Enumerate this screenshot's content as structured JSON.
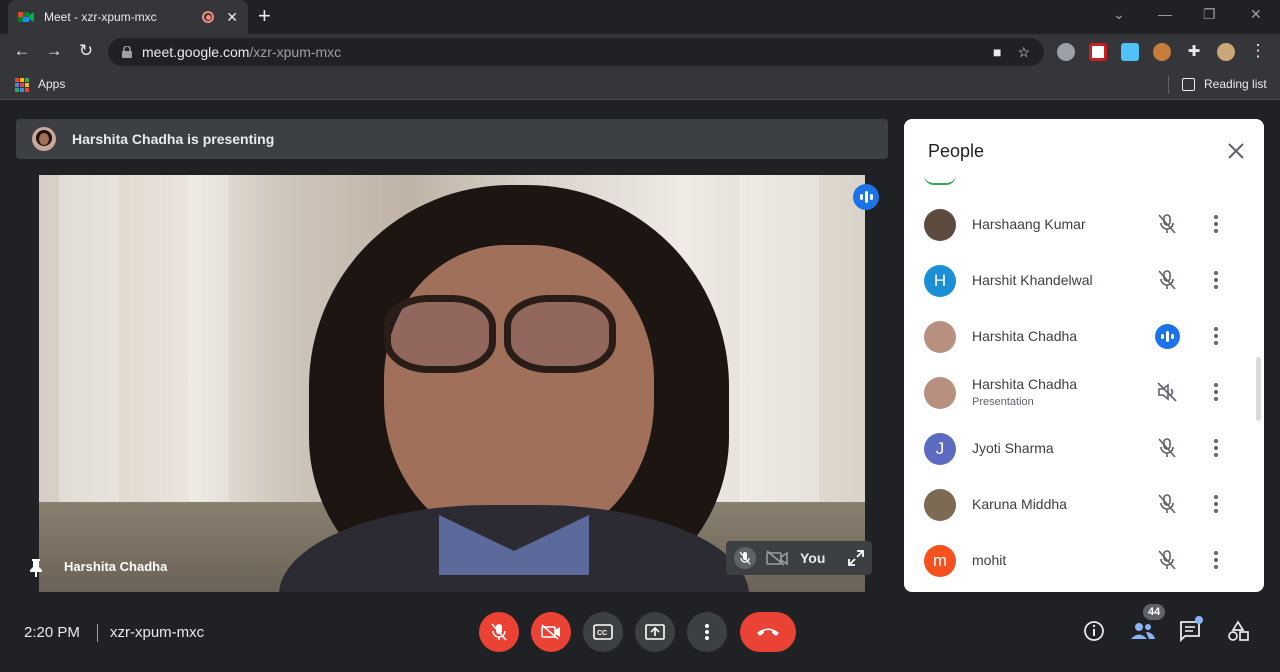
{
  "browser": {
    "tab_title": "Meet - xzr-xpum-mxc",
    "url_host": "meet.google.com",
    "url_path": "/xzr-xpum-mxc",
    "bookmarks": {
      "apps_label": "Apps",
      "reading_list_label": "Reading list"
    }
  },
  "meeting": {
    "presenting_banner": "Harshita Chadha is presenting",
    "main_video_name": "Harshita Chadha",
    "self_tile_label": "You",
    "time": "2:20 PM",
    "code": "xzr-xpum-mxc",
    "participant_count": "44"
  },
  "people_panel": {
    "title": "People",
    "participants": [
      {
        "name": "Harshaang Kumar",
        "sub": "",
        "avatar_letter": "",
        "avatar_color": "#5c4a3f",
        "state": "muted"
      },
      {
        "name": "Harshit Khandelwal",
        "sub": "",
        "avatar_letter": "H",
        "avatar_color": "#1a8fd6",
        "state": "muted"
      },
      {
        "name": "Harshita Chadha",
        "sub": "",
        "avatar_letter": "",
        "avatar_color": "#b89080",
        "state": "speaking"
      },
      {
        "name": "Harshita Chadha",
        "sub": "Presentation",
        "avatar_letter": "",
        "avatar_color": "#b89080",
        "state": "audio-off"
      },
      {
        "name": "Jyoti Sharma",
        "sub": "",
        "avatar_letter": "J",
        "avatar_color": "#5c6bc0",
        "state": "muted"
      },
      {
        "name": "Karuna Middha",
        "sub": "",
        "avatar_letter": "",
        "avatar_color": "#7d6a55",
        "state": "muted"
      },
      {
        "name": "mohit",
        "sub": "",
        "avatar_letter": "m",
        "avatar_color": "#f4511e",
        "state": "muted"
      }
    ]
  },
  "colors": {
    "accent": "#1a73e8",
    "danger": "#ea4335",
    "bg": "#202124"
  }
}
